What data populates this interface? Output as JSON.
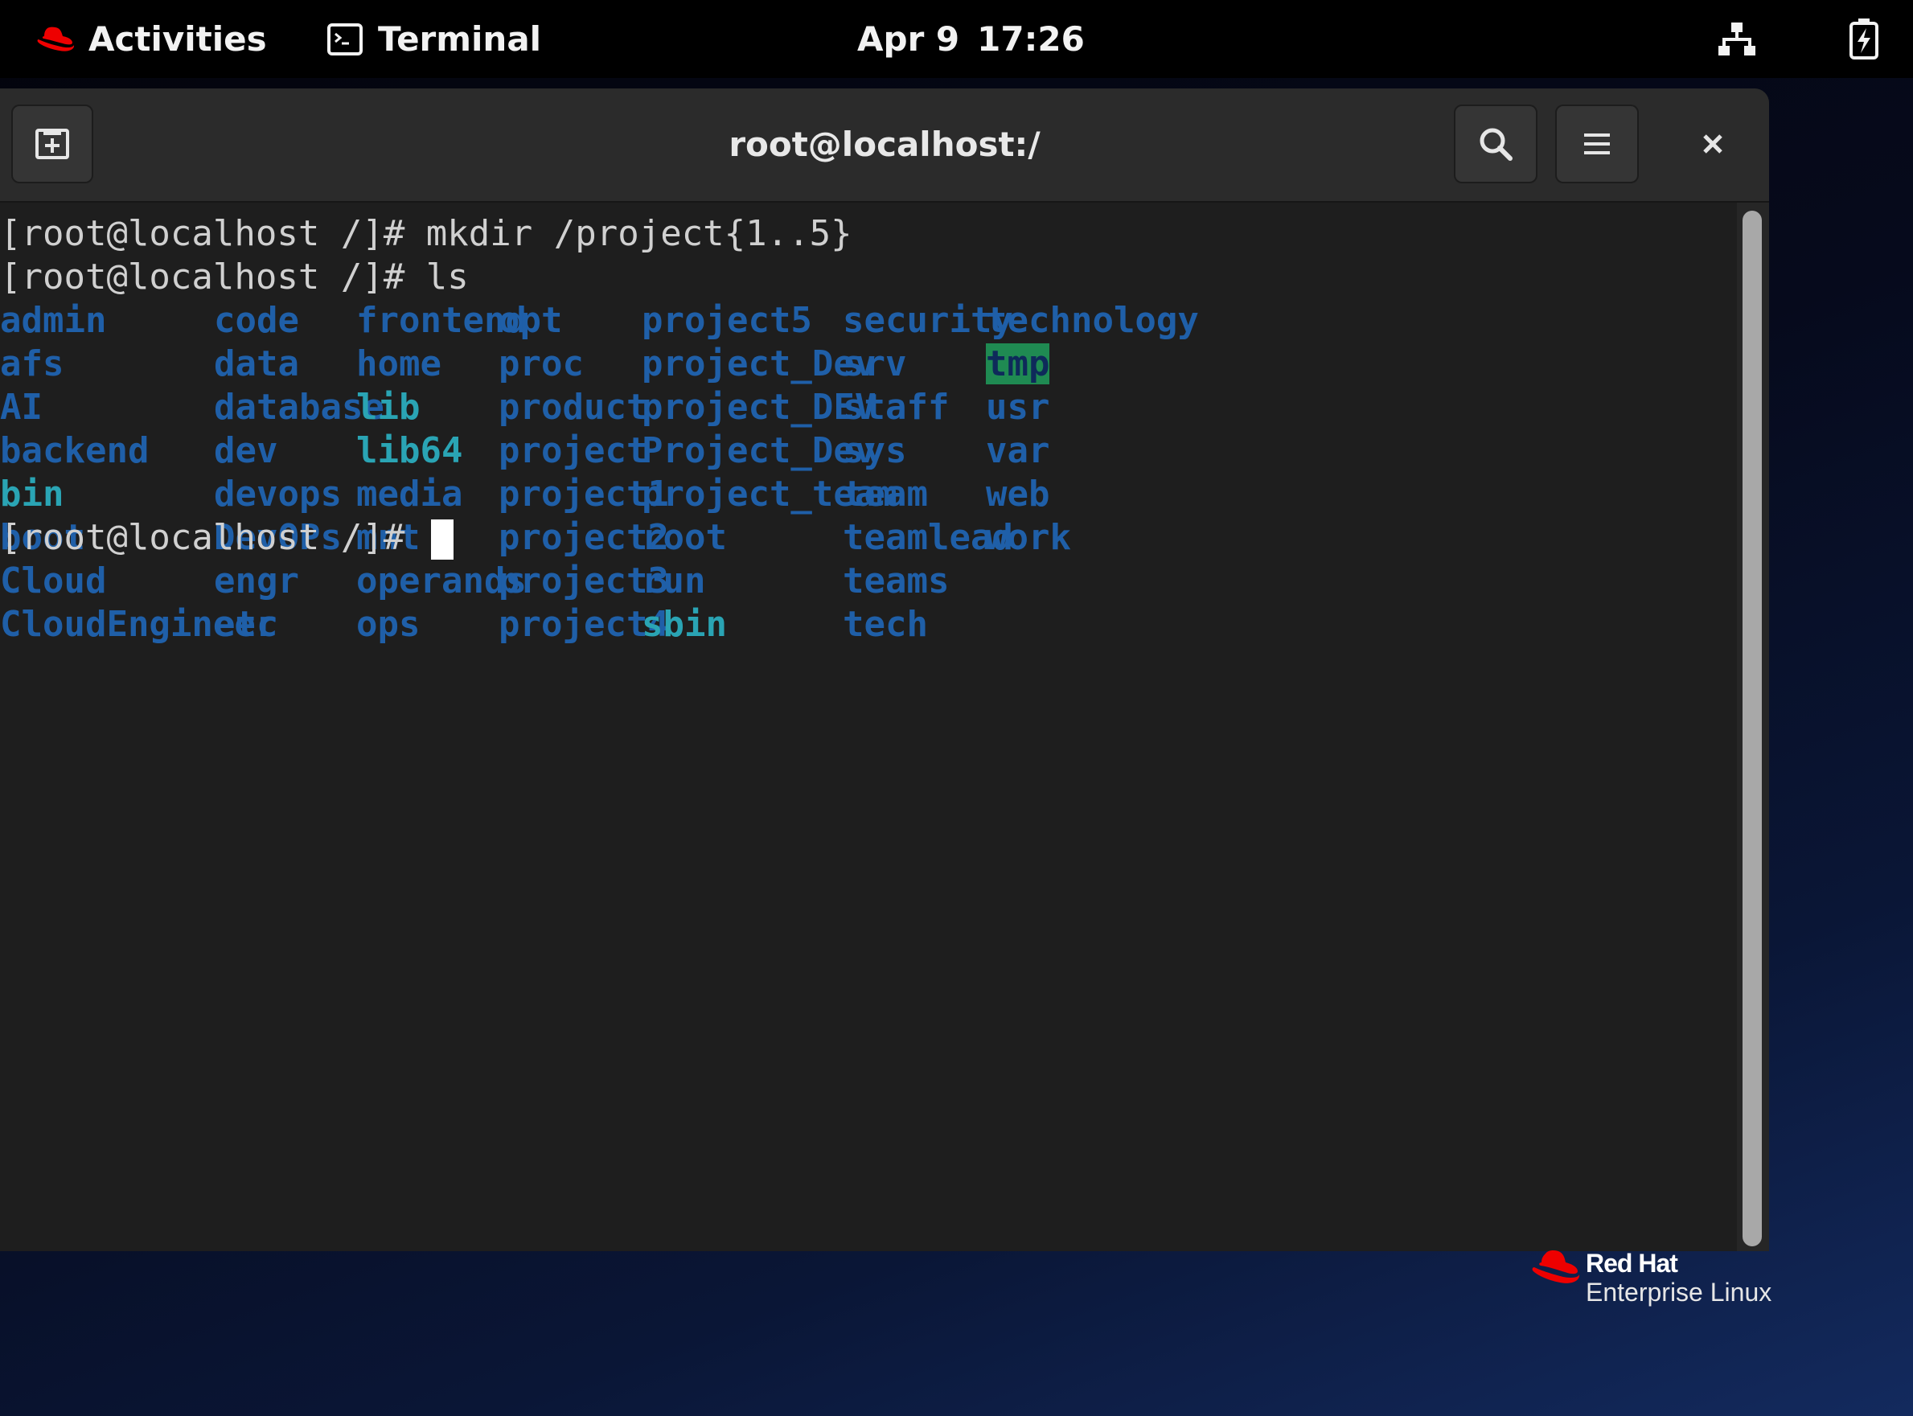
{
  "topbar": {
    "activities_label": "Activities",
    "app_label": "Terminal",
    "date": "Apr 9",
    "time": "17:26"
  },
  "window": {
    "title": "root@localhost:/"
  },
  "terminal": {
    "lines": [
      "[root@localhost /]# mkdir /project{1..5}",
      "[root@localhost /]# ls",
      "[root@localhost /]# "
    ],
    "ls_columns": [
      [
        "admin",
        "afs",
        "AI",
        "backend",
        "bin",
        "boot",
        "Cloud",
        "CloudEngineer"
      ],
      [
        "code",
        "data",
        "database",
        "dev",
        "devops",
        "DevOPs",
        "engr",
        "etc"
      ],
      [
        "frontend",
        "home",
        "lib",
        "lib64",
        "media",
        "mnt",
        "operands",
        "ops"
      ],
      [
        "opt",
        "proc",
        "product",
        "project",
        "project1",
        "project2",
        "project3",
        "project4"
      ],
      [
        "project5",
        "project_Dev",
        "project_DEV",
        "Project_Dev",
        "project_team",
        "root",
        "run",
        "sbin"
      ],
      [
        "security",
        "srv",
        "staff",
        "sys",
        "team",
        "teamlead",
        "teams",
        "tech"
      ],
      [
        "technology",
        "tmp",
        "usr",
        "var",
        "web",
        "work"
      ]
    ],
    "symlinks": [
      "bin",
      "lib",
      "lib64",
      "sbin"
    ],
    "highlighted": [
      "tmp"
    ]
  },
  "branding": {
    "line1": "Red Hat",
    "line2": "Enterprise Linux"
  },
  "colors": {
    "directory": "#1f5fa8",
    "symlink": "#2aa4b4",
    "sticky_dir_bg": "#1f8a52",
    "terminal_bg": "#1e1e1e",
    "headerbar_bg": "#2b2b2b",
    "redhat_red": "#ee0000"
  },
  "icons": {
    "activities": "redhat-fedora-icon",
    "app": "terminal-icon",
    "network": "network-wired-icon",
    "battery": "battery-charging-icon",
    "new_tab": "new-tab-icon",
    "search": "search-icon",
    "menu": "hamburger-menu-icon",
    "close": "close-icon"
  }
}
